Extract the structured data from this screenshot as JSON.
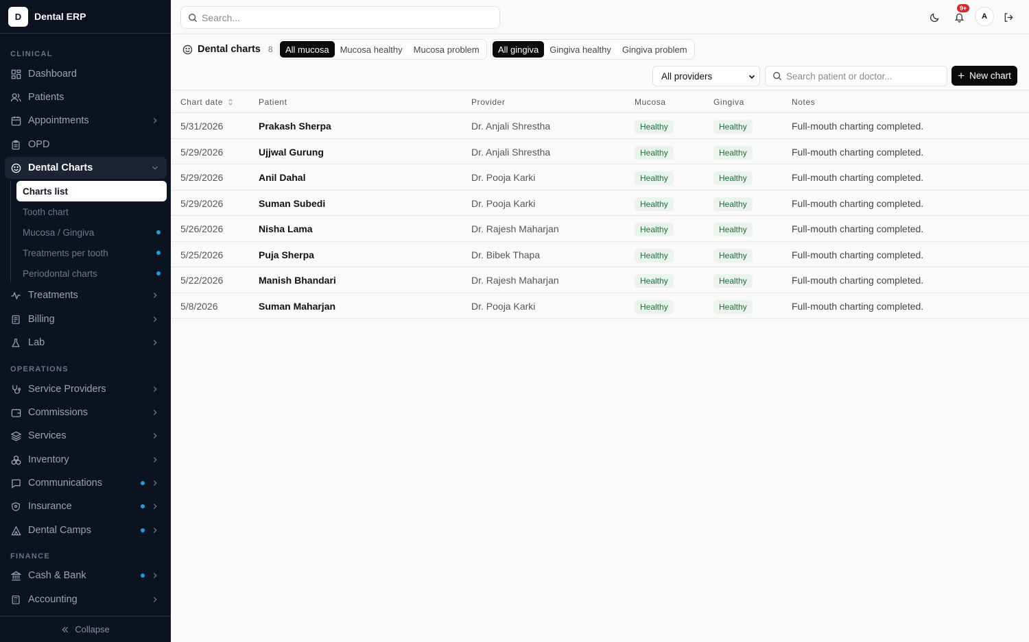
{
  "brand": {
    "logo_letter": "D",
    "name": "Dental ERP"
  },
  "sidebar": {
    "sections": {
      "clinical": "CLINICAL",
      "operations": "OPERATIONS",
      "finance": "FINANCE"
    },
    "items": [
      {
        "label": "Dashboard"
      },
      {
        "label": "Patients"
      },
      {
        "label": "Appointments"
      },
      {
        "label": "OPD"
      },
      {
        "label": "Dental Charts"
      },
      {
        "label": "Treatments"
      },
      {
        "label": "Billing"
      },
      {
        "label": "Lab"
      },
      {
        "label": "Service Providers"
      },
      {
        "label": "Commissions"
      },
      {
        "label": "Services"
      },
      {
        "label": "Inventory"
      },
      {
        "label": "Communications"
      },
      {
        "label": "Insurance"
      },
      {
        "label": "Dental Camps"
      },
      {
        "label": "Cash & Bank"
      },
      {
        "label": "Accounting"
      }
    ],
    "subitems": [
      {
        "label": "Charts list"
      },
      {
        "label": "Tooth chart"
      },
      {
        "label": "Mucosa / Gingiva"
      },
      {
        "label": "Treatments per tooth"
      },
      {
        "label": "Periodontal charts"
      }
    ],
    "collapse_label": "Collapse",
    "dot_color": "#16a0e6"
  },
  "topbar": {
    "search_placeholder": "Search...",
    "notification_badge": "9+",
    "avatar_letter": "A"
  },
  "page": {
    "title": "Dental charts",
    "count": "8",
    "mucosa_filters": [
      "All mucosa",
      "Mucosa healthy",
      "Mucosa problem"
    ],
    "gingiva_filters": [
      "All gingiva",
      "Gingiva healthy",
      "Gingiva problem"
    ],
    "provider_select": "All providers",
    "table_search_placeholder": "Search patient or doctor...",
    "new_button": "New chart"
  },
  "table": {
    "columns": [
      "Chart date",
      "Patient",
      "Provider",
      "Mucosa",
      "Gingiva",
      "Notes"
    ],
    "rows": [
      {
        "date": "5/31/2026",
        "patient": "Prakash Sherpa",
        "provider": "Dr. Anjali Shrestha",
        "mucosa": "Healthy",
        "gingiva": "Healthy",
        "notes": "Full-mouth charting completed."
      },
      {
        "date": "5/29/2026",
        "patient": "Ujjwal Gurung",
        "provider": "Dr. Anjali Shrestha",
        "mucosa": "Healthy",
        "gingiva": "Healthy",
        "notes": "Full-mouth charting completed."
      },
      {
        "date": "5/29/2026",
        "patient": "Anil Dahal",
        "provider": "Dr. Pooja Karki",
        "mucosa": "Healthy",
        "gingiva": "Healthy",
        "notes": "Full-mouth charting completed."
      },
      {
        "date": "5/29/2026",
        "patient": "Suman Subedi",
        "provider": "Dr. Pooja Karki",
        "mucosa": "Healthy",
        "gingiva": "Healthy",
        "notes": "Full-mouth charting completed."
      },
      {
        "date": "5/26/2026",
        "patient": "Nisha Lama",
        "provider": "Dr. Rajesh Maharjan",
        "mucosa": "Healthy",
        "gingiva": "Healthy",
        "notes": "Full-mouth charting completed."
      },
      {
        "date": "5/25/2026",
        "patient": "Puja Sherpa",
        "provider": "Dr. Bibek Thapa",
        "mucosa": "Healthy",
        "gingiva": "Healthy",
        "notes": "Full-mouth charting completed."
      },
      {
        "date": "5/22/2026",
        "patient": "Manish Bhandari",
        "provider": "Dr. Rajesh Maharjan",
        "mucosa": "Healthy",
        "gingiva": "Healthy",
        "notes": "Full-mouth charting completed."
      },
      {
        "date": "5/8/2026",
        "patient": "Suman Maharjan",
        "provider": "Dr. Pooja Karki",
        "mucosa": "Healthy",
        "gingiva": "Healthy",
        "notes": "Full-mouth charting completed."
      }
    ]
  }
}
